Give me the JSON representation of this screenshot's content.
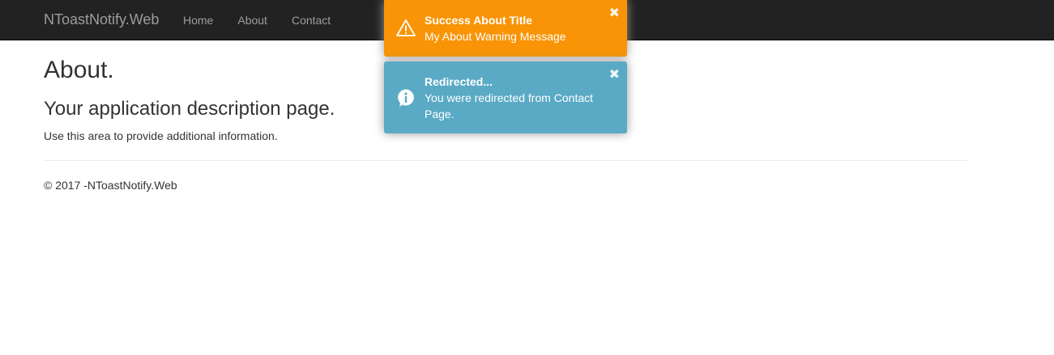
{
  "navbar": {
    "brand": "NToastNotify.Web",
    "links": [
      {
        "label": "Home"
      },
      {
        "label": "About"
      },
      {
        "label": "Contact"
      }
    ]
  },
  "main": {
    "title": "About.",
    "subtitle": "Your application description page.",
    "text": "Use this area to provide additional information."
  },
  "footer": {
    "text": "© 2017 -NToastNotify.Web"
  },
  "toasts": [
    {
      "type": "warning",
      "icon": "warning-triangle-icon",
      "title": "Success About Title",
      "message": "My About Warning Message",
      "close": "✖",
      "color": "#f89406"
    },
    {
      "type": "info",
      "icon": "info-bubble-icon",
      "title": "Redirected...",
      "message": "You were redirected from Contact Page.",
      "close": "✖",
      "color": "#5aaac6"
    }
  ],
  "colors": {
    "navbar_bg": "#222222",
    "nav_text": "#9d9d9d",
    "body_text": "#333333"
  }
}
